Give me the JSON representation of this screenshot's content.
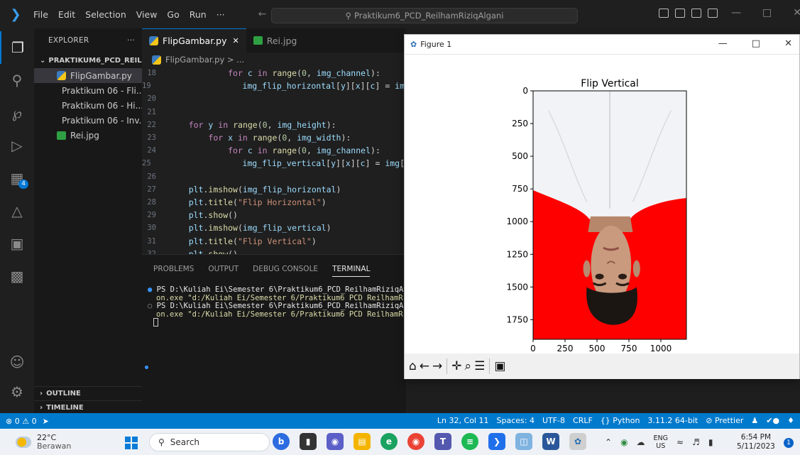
{
  "titlebar": {
    "menu": [
      "File",
      "Edit",
      "Selection",
      "View",
      "Go",
      "Run",
      "···"
    ],
    "search_text": "Praktikum6_PCD_ReilhamRiziqAlgani"
  },
  "sidebar": {
    "header": "EXPLORER",
    "header_more": "···",
    "project": "PRAKTIKUM6_PCD_REILHA...",
    "files": [
      {
        "name": "FlipGambar.py",
        "type": "py"
      },
      {
        "name": "Praktikum 06 - Fli...",
        "type": "html"
      },
      {
        "name": "Praktikum 06 - Hi...",
        "type": "html"
      },
      {
        "name": "Praktikum 06 - Inv...",
        "type": "html"
      },
      {
        "name": "Rei.jpg",
        "type": "img"
      }
    ],
    "outline": "OUTLINE",
    "timeline": "TIMELINE"
  },
  "editor": {
    "tabs": [
      {
        "label": "FlipGambar.py",
        "close": "✕"
      },
      {
        "label": "Rei.jpg"
      }
    ],
    "breadcrumb": "FlipGambar.py > ...",
    "lines": [
      {
        "n": "18",
        "code": "            for c in range(0, img_channel):"
      },
      {
        "n": "19",
        "code": "                img_flip_horizontal[y][x][c] = img"
      },
      {
        "n": "20",
        "code": ""
      },
      {
        "n": "21",
        "code": ""
      },
      {
        "n": "22",
        "code": "    for y in range(0, img_height):"
      },
      {
        "n": "23",
        "code": "        for x in range(0, img_width):"
      },
      {
        "n": "24",
        "code": "            for c in range(0, img_channel):"
      },
      {
        "n": "25",
        "code": "                img_flip_vertical[y][x][c] = img[i"
      },
      {
        "n": "26",
        "code": ""
      },
      {
        "n": "27",
        "code": "    plt.imshow(img_flip_horizontal)"
      },
      {
        "n": "28",
        "code": "    plt.title(\"Flip Horizontal\")"
      },
      {
        "n": "29",
        "code": "    plt.show()"
      },
      {
        "n": "30",
        "code": "    plt.imshow(img_flip_vertical)"
      },
      {
        "n": "31",
        "code": "    plt.title(\"Flip Vertical\")"
      },
      {
        "n": "32",
        "code": "    plt.show()"
      },
      {
        "n": "33",
        "code": ""
      }
    ]
  },
  "panel": {
    "tabs": [
      "PROBLEMS",
      "OUTPUT",
      "DEBUG CONSOLE",
      "TERMINAL"
    ],
    "terminal": [
      "PS D:\\Kuliah Ei\\Semester 6\\Praktikum6_PCD_ReilhamRiziqA",
      "on.exe \"d:/Kuliah Ei/Semester 6/Praktikum6_PCD_ReilhamR",
      "PS D:\\Kuliah Ei\\Semester 6\\Praktikum6_PCD_ReilhamRiziqA",
      "on.exe \"d:/Kuliah Ei/Semester 6/Praktikum6_PCD_ReilhamR"
    ]
  },
  "statusbar": {
    "left": [
      "⊗ 0 ⚠ 0"
    ],
    "right": [
      "Ln 32, Col 11",
      "Spaces: 4",
      "UTF-8",
      "CRLF",
      "{} Python",
      "3.11.2 64-bit",
      "⊘ Prettier"
    ]
  },
  "figure": {
    "window_title": "Figure 1",
    "toolbar": [
      "⌂",
      "←",
      "→",
      "✛",
      "⌕",
      "☰",
      "▣"
    ]
  },
  "chart_data": {
    "type": "image",
    "title": "Flip Vertical",
    "xticks": [
      0,
      250,
      500,
      750,
      1000
    ],
    "yticks": [
      0,
      250,
      500,
      750,
      1000,
      1250,
      1500,
      1750
    ],
    "xlim": [
      0,
      1200
    ],
    "ylim": [
      1900,
      0
    ],
    "colors": {
      "background_red": "#ff0000",
      "shirt": "#f2f3f6",
      "skin": "#c99a7e",
      "hair": "#1b1612"
    }
  },
  "taskbar": {
    "temp": "22°C",
    "weather": "Berawan",
    "search": "Search",
    "lang_top": "ENG",
    "lang_bottom": "US",
    "time": "6:54 PM",
    "date": "5/11/2023",
    "notif": "1"
  }
}
